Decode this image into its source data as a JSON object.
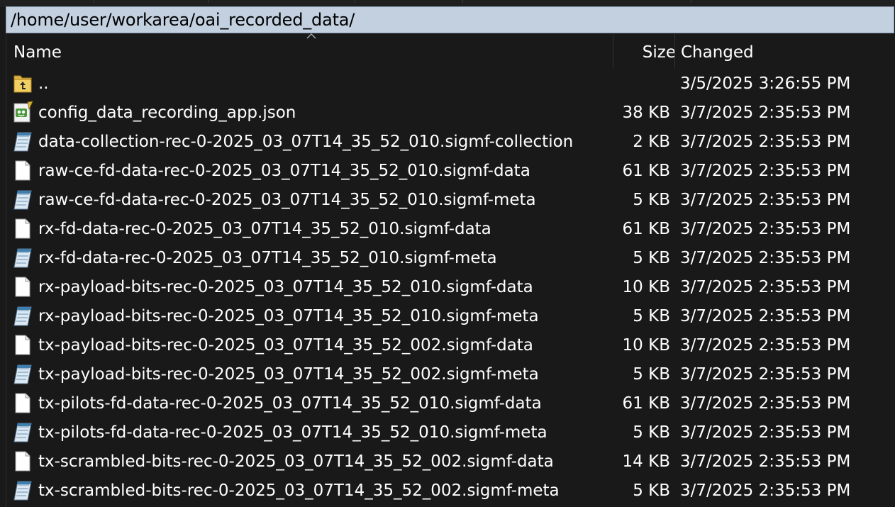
{
  "path_bar": {
    "path": "/home/user/workarea/oai_recorded_data/"
  },
  "columns": {
    "name": "Name",
    "size": "Size",
    "changed": "Changed",
    "sort_indicator_icon": "sort-ascending-icon"
  },
  "files": [
    {
      "name": "..",
      "size": "",
      "changed": "3/5/2025 3:26:55 PM",
      "icon": "parent-folder-icon"
    },
    {
      "name": "config_data_recording_app.json",
      "size": "38 KB",
      "changed": "3/7/2025 2:35:53 PM",
      "icon": "json-file-icon"
    },
    {
      "name": "data-collection-rec-0-2025_03_07T14_35_52_010.sigmf-collection",
      "size": "2 KB",
      "changed": "3/7/2025 2:35:53 PM",
      "icon": "notepad-file-icon"
    },
    {
      "name": "raw-ce-fd-data-rec-0-2025_03_07T14_35_52_010.sigmf-data",
      "size": "61 KB",
      "changed": "3/7/2025 2:35:53 PM",
      "icon": "blank-file-icon"
    },
    {
      "name": "raw-ce-fd-data-rec-0-2025_03_07T14_35_52_010.sigmf-meta",
      "size": "5 KB",
      "changed": "3/7/2025 2:35:53 PM",
      "icon": "notepad-file-icon"
    },
    {
      "name": "rx-fd-data-rec-0-2025_03_07T14_35_52_010.sigmf-data",
      "size": "61 KB",
      "changed": "3/7/2025 2:35:53 PM",
      "icon": "blank-file-icon"
    },
    {
      "name": "rx-fd-data-rec-0-2025_03_07T14_35_52_010.sigmf-meta",
      "size": "5 KB",
      "changed": "3/7/2025 2:35:53 PM",
      "icon": "notepad-file-icon"
    },
    {
      "name": "rx-payload-bits-rec-0-2025_03_07T14_35_52_010.sigmf-data",
      "size": "10 KB",
      "changed": "3/7/2025 2:35:53 PM",
      "icon": "blank-file-icon"
    },
    {
      "name": "rx-payload-bits-rec-0-2025_03_07T14_35_52_010.sigmf-meta",
      "size": "5 KB",
      "changed": "3/7/2025 2:35:53 PM",
      "icon": "notepad-file-icon"
    },
    {
      "name": "tx-payload-bits-rec-0-2025_03_07T14_35_52_002.sigmf-data",
      "size": "10 KB",
      "changed": "3/7/2025 2:35:53 PM",
      "icon": "blank-file-icon"
    },
    {
      "name": "tx-payload-bits-rec-0-2025_03_07T14_35_52_002.sigmf-meta",
      "size": "5 KB",
      "changed": "3/7/2025 2:35:53 PM",
      "icon": "notepad-file-icon"
    },
    {
      "name": "tx-pilots-fd-data-rec-0-2025_03_07T14_35_52_010.sigmf-data",
      "size": "61 KB",
      "changed": "3/7/2025 2:35:53 PM",
      "icon": "blank-file-icon"
    },
    {
      "name": "tx-pilots-fd-data-rec-0-2025_03_07T14_35_52_010.sigmf-meta",
      "size": "5 KB",
      "changed": "3/7/2025 2:35:53 PM",
      "icon": "notepad-file-icon"
    },
    {
      "name": "tx-scrambled-bits-rec-0-2025_03_07T14_35_52_002.sigmf-data",
      "size": "14 KB",
      "changed": "3/7/2025 2:35:53 PM",
      "icon": "blank-file-icon"
    },
    {
      "name": "tx-scrambled-bits-rec-0-2025_03_07T14_35_52_002.sigmf-meta",
      "size": "5 KB",
      "changed": "3/7/2025 2:35:53 PM",
      "icon": "notepad-file-icon"
    }
  ],
  "colors": {
    "background": "#191919",
    "text": "#ffffff",
    "path_bar_background": "#c2d0e0",
    "folder_icon": "#e8c04a"
  }
}
